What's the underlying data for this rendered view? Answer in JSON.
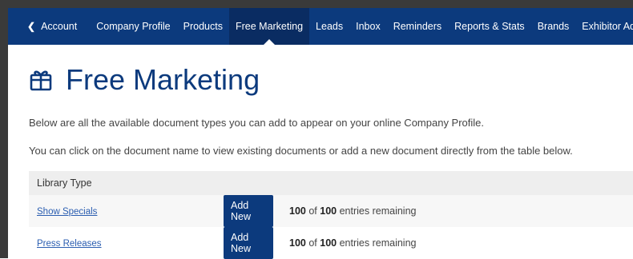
{
  "nav": {
    "back_label": "Account",
    "items": [
      {
        "label": "Company Profile"
      },
      {
        "label": "Products"
      },
      {
        "label": "Free Marketing",
        "active": true
      },
      {
        "label": "Leads"
      },
      {
        "label": "Inbox"
      },
      {
        "label": "Reminders"
      },
      {
        "label": "Reports & Stats"
      },
      {
        "label": "Brands"
      },
      {
        "label": "Exhibitor Admins"
      }
    ]
  },
  "page": {
    "title": "Free Marketing",
    "title_icon": "gift-icon",
    "intro1": "Below are all the available document types you can add to appear on your online Company Profile.",
    "intro2": "You can click on the document name to view existing documents or add a new document directly from the table below."
  },
  "table": {
    "header": "Library Type",
    "rows": [
      {
        "name": "Show Specials",
        "button": "Add New",
        "used": "100",
        "of": "of",
        "total": "100",
        "suffix": "entries remaining"
      },
      {
        "name": "Press Releases",
        "button": "Add New",
        "used": "100",
        "of": "of",
        "total": "100",
        "suffix": "entries remaining"
      }
    ]
  },
  "colors": {
    "nav_bg": "#0c3a7d",
    "accent": "#0c3a7d",
    "link": "#2a5db0"
  }
}
